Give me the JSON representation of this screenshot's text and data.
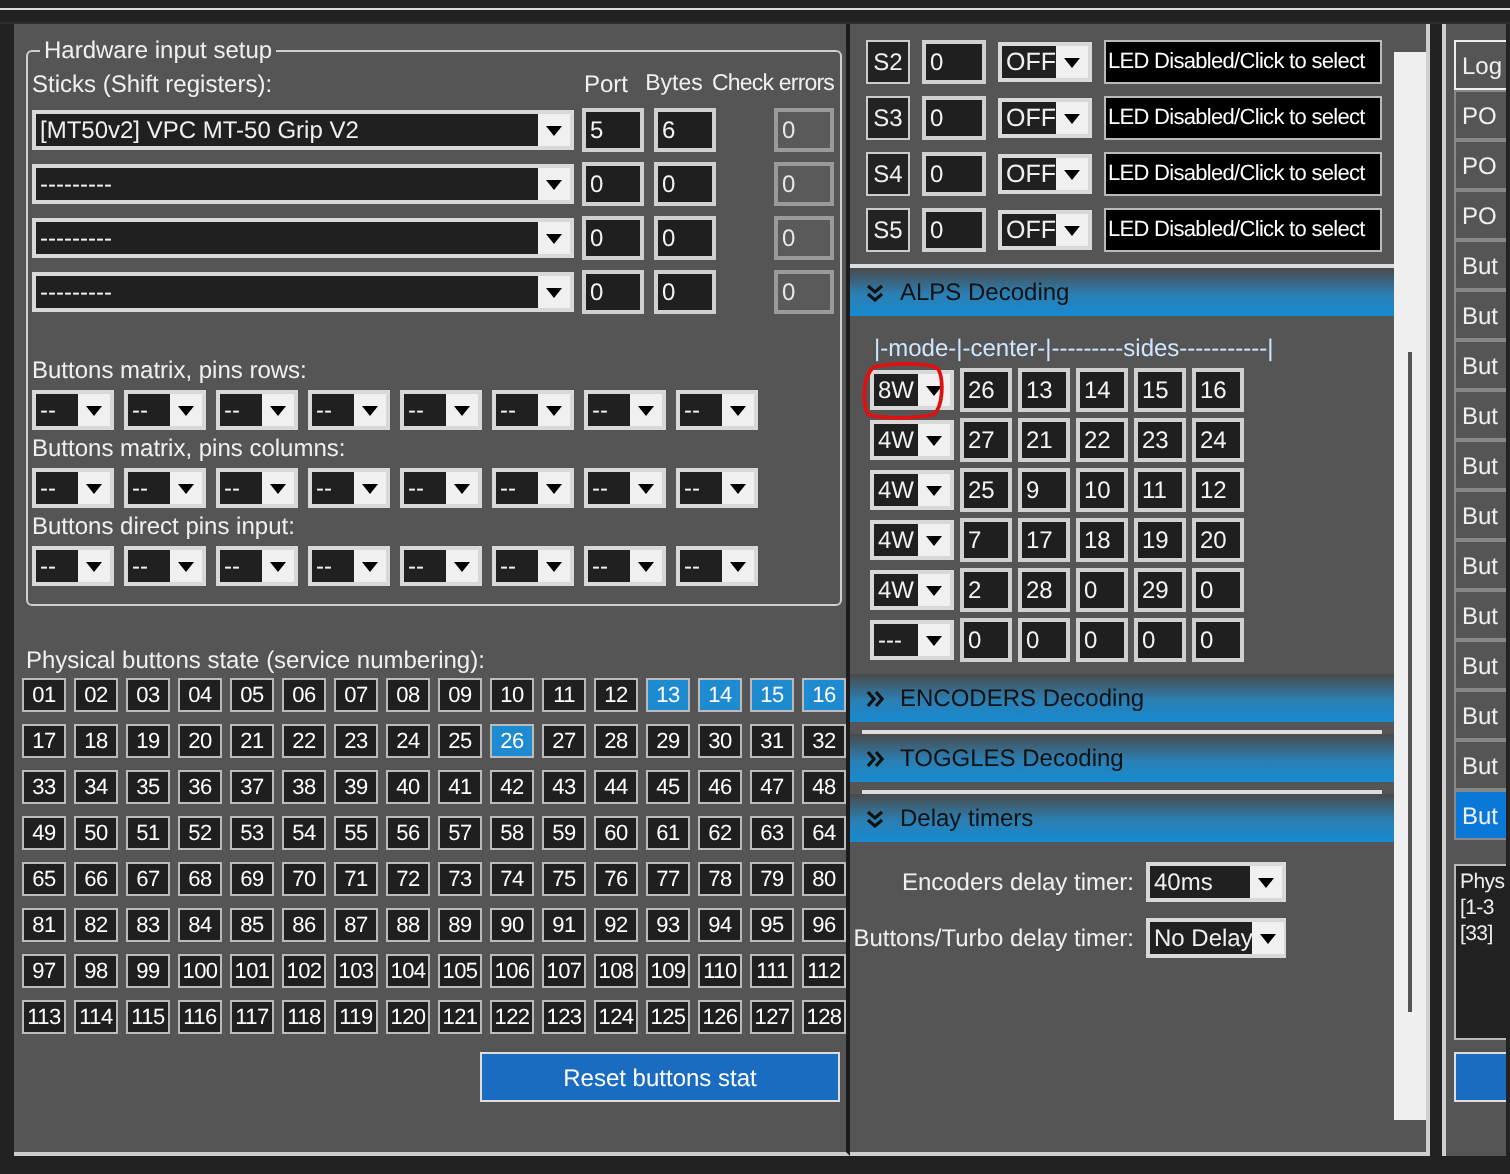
{
  "hardware_input_setup": {
    "title": "Hardware input setup",
    "sticks_label": "Sticks (Shift registers):",
    "column_headers": [
      "Port",
      "Bytes",
      "Check errors"
    ],
    "sticks": [
      {
        "device": "[MT50v2] VPC MT-50 Grip V2",
        "port": "5",
        "bytes": "6",
        "check_errors": "0"
      },
      {
        "device": "---------",
        "port": "0",
        "bytes": "0",
        "check_errors": "0"
      },
      {
        "device": "---------",
        "port": "0",
        "bytes": "0",
        "check_errors": "0"
      },
      {
        "device": "---------",
        "port": "0",
        "bytes": "0",
        "check_errors": "0"
      }
    ],
    "pin_groups": [
      {
        "label": "Buttons matrix, pins rows:",
        "pins": [
          "--",
          "--",
          "--",
          "--",
          "--",
          "--",
          "--",
          "--"
        ]
      },
      {
        "label": "Buttons matrix, pins columns:",
        "pins": [
          "--",
          "--",
          "--",
          "--",
          "--",
          "--",
          "--",
          "--"
        ]
      },
      {
        "label": "Buttons direct pins input:",
        "pins": [
          "--",
          "--",
          "--",
          "--",
          "--",
          "--",
          "--",
          "--"
        ]
      }
    ]
  },
  "physical_buttons": {
    "label": "Physical buttons state (service numbering):",
    "buttons": [
      {
        "number": "01",
        "pressed": false
      },
      {
        "number": "02",
        "pressed": false
      },
      {
        "number": "03",
        "pressed": false
      },
      {
        "number": "04",
        "pressed": false
      },
      {
        "number": "05",
        "pressed": false
      },
      {
        "number": "06",
        "pressed": false
      },
      {
        "number": "07",
        "pressed": false
      },
      {
        "number": "08",
        "pressed": false
      },
      {
        "number": "09",
        "pressed": false
      },
      {
        "number": "10",
        "pressed": false
      },
      {
        "number": "11",
        "pressed": false
      },
      {
        "number": "12",
        "pressed": false
      },
      {
        "number": "13",
        "pressed": true
      },
      {
        "number": "14",
        "pressed": true
      },
      {
        "number": "15",
        "pressed": true
      },
      {
        "number": "16",
        "pressed": true
      },
      {
        "number": "17",
        "pressed": false
      },
      {
        "number": "18",
        "pressed": false
      },
      {
        "number": "19",
        "pressed": false
      },
      {
        "number": "20",
        "pressed": false
      },
      {
        "number": "21",
        "pressed": false
      },
      {
        "number": "22",
        "pressed": false
      },
      {
        "number": "23",
        "pressed": false
      },
      {
        "number": "24",
        "pressed": false
      },
      {
        "number": "25",
        "pressed": false
      },
      {
        "number": "26",
        "pressed": true
      },
      {
        "number": "27",
        "pressed": false
      },
      {
        "number": "28",
        "pressed": false
      },
      {
        "number": "29",
        "pressed": false
      },
      {
        "number": "30",
        "pressed": false
      },
      {
        "number": "31",
        "pressed": false
      },
      {
        "number": "32",
        "pressed": false
      },
      {
        "number": "33",
        "pressed": false
      },
      {
        "number": "34",
        "pressed": false
      },
      {
        "number": "35",
        "pressed": false
      },
      {
        "number": "36",
        "pressed": false
      },
      {
        "number": "37",
        "pressed": false
      },
      {
        "number": "38",
        "pressed": false
      },
      {
        "number": "39",
        "pressed": false
      },
      {
        "number": "40",
        "pressed": false
      },
      {
        "number": "41",
        "pressed": false
      },
      {
        "number": "42",
        "pressed": false
      },
      {
        "number": "43",
        "pressed": false
      },
      {
        "number": "44",
        "pressed": false
      },
      {
        "number": "45",
        "pressed": false
      },
      {
        "number": "46",
        "pressed": false
      },
      {
        "number": "47",
        "pressed": false
      },
      {
        "number": "48",
        "pressed": false
      },
      {
        "number": "49",
        "pressed": false
      },
      {
        "number": "50",
        "pressed": false
      },
      {
        "number": "51",
        "pressed": false
      },
      {
        "number": "52",
        "pressed": false
      },
      {
        "number": "53",
        "pressed": false
      },
      {
        "number": "54",
        "pressed": false
      },
      {
        "number": "55",
        "pressed": false
      },
      {
        "number": "56",
        "pressed": false
      },
      {
        "number": "57",
        "pressed": false
      },
      {
        "number": "58",
        "pressed": false
      },
      {
        "number": "59",
        "pressed": false
      },
      {
        "number": "60",
        "pressed": false
      },
      {
        "number": "61",
        "pressed": false
      },
      {
        "number": "62",
        "pressed": false
      },
      {
        "number": "63",
        "pressed": false
      },
      {
        "number": "64",
        "pressed": false
      },
      {
        "number": "65",
        "pressed": false
      },
      {
        "number": "66",
        "pressed": false
      },
      {
        "number": "67",
        "pressed": false
      },
      {
        "number": "68",
        "pressed": false
      },
      {
        "number": "69",
        "pressed": false
      },
      {
        "number": "70",
        "pressed": false
      },
      {
        "number": "71",
        "pressed": false
      },
      {
        "number": "72",
        "pressed": false
      },
      {
        "number": "73",
        "pressed": false
      },
      {
        "number": "74",
        "pressed": false
      },
      {
        "number": "75",
        "pressed": false
      },
      {
        "number": "76",
        "pressed": false
      },
      {
        "number": "77",
        "pressed": false
      },
      {
        "number": "78",
        "pressed": false
      },
      {
        "number": "79",
        "pressed": false
      },
      {
        "number": "80",
        "pressed": false
      },
      {
        "number": "81",
        "pressed": false
      },
      {
        "number": "82",
        "pressed": false
      },
      {
        "number": "83",
        "pressed": false
      },
      {
        "number": "84",
        "pressed": false
      },
      {
        "number": "85",
        "pressed": false
      },
      {
        "number": "86",
        "pressed": false
      },
      {
        "number": "87",
        "pressed": false
      },
      {
        "number": "88",
        "pressed": false
      },
      {
        "number": "89",
        "pressed": false
      },
      {
        "number": "90",
        "pressed": false
      },
      {
        "number": "91",
        "pressed": false
      },
      {
        "number": "92",
        "pressed": false
      },
      {
        "number": "93",
        "pressed": false
      },
      {
        "number": "94",
        "pressed": false
      },
      {
        "number": "95",
        "pressed": false
      },
      {
        "number": "96",
        "pressed": false
      },
      {
        "number": "97",
        "pressed": false
      },
      {
        "number": "98",
        "pressed": false
      },
      {
        "number": "99",
        "pressed": false
      },
      {
        "number": "100",
        "pressed": false
      },
      {
        "number": "101",
        "pressed": false
      },
      {
        "number": "102",
        "pressed": false
      },
      {
        "number": "103",
        "pressed": false
      },
      {
        "number": "104",
        "pressed": false
      },
      {
        "number": "105",
        "pressed": false
      },
      {
        "number": "106",
        "pressed": false
      },
      {
        "number": "107",
        "pressed": false
      },
      {
        "number": "108",
        "pressed": false
      },
      {
        "number": "109",
        "pressed": false
      },
      {
        "number": "110",
        "pressed": false
      },
      {
        "number": "111",
        "pressed": false
      },
      {
        "number": "112",
        "pressed": false
      },
      {
        "number": "113",
        "pressed": false
      },
      {
        "number": "114",
        "pressed": false
      },
      {
        "number": "115",
        "pressed": false
      },
      {
        "number": "116",
        "pressed": false
      },
      {
        "number": "117",
        "pressed": false
      },
      {
        "number": "118",
        "pressed": false
      },
      {
        "number": "119",
        "pressed": false
      },
      {
        "number": "120",
        "pressed": false
      },
      {
        "number": "121",
        "pressed": false
      },
      {
        "number": "122",
        "pressed": false
      },
      {
        "number": "123",
        "pressed": false
      },
      {
        "number": "124",
        "pressed": false
      },
      {
        "number": "125",
        "pressed": false
      },
      {
        "number": "126",
        "pressed": false
      },
      {
        "number": "127",
        "pressed": false
      },
      {
        "number": "128",
        "pressed": false
      }
    ],
    "reset_button": "Reset buttons stat"
  },
  "shift_registers": [
    {
      "label": "S2",
      "value": "0",
      "mode": "OFF",
      "led": "LED Disabled/Click to select"
    },
    {
      "label": "S3",
      "value": "0",
      "mode": "OFF",
      "led": "LED Disabled/Click to select"
    },
    {
      "label": "S4",
      "value": "0",
      "mode": "OFF",
      "led": "LED Disabled/Click to select"
    },
    {
      "label": "S5",
      "value": "0",
      "mode": "OFF",
      "led": "LED Disabled/Click to select"
    }
  ],
  "sections": [
    {
      "kind": "alps",
      "title": "ALPS Decoding",
      "expanded": true,
      "header": "|-mode-|-center-|---------sides-----------|",
      "rows": [
        {
          "mode": "8W",
          "values": [
            "26",
            "13",
            "14",
            "15",
            "16"
          ]
        },
        {
          "mode": "4W",
          "values": [
            "27",
            "21",
            "22",
            "23",
            "24"
          ]
        },
        {
          "mode": "4W",
          "values": [
            "25",
            "9",
            "10",
            "11",
            "12"
          ]
        },
        {
          "mode": "4W",
          "values": [
            "7",
            "17",
            "18",
            "19",
            "20"
          ]
        },
        {
          "mode": "4W",
          "values": [
            "2",
            "28",
            "0",
            "29",
            "0"
          ]
        },
        {
          "mode": "---",
          "values": [
            "0",
            "0",
            "0",
            "0",
            "0"
          ]
        }
      ]
    },
    {
      "kind": "plain",
      "title": "ENCODERS Decoding",
      "expanded": false
    },
    {
      "kind": "plain",
      "title": "TOGGLES Decoding",
      "expanded": false
    },
    {
      "kind": "timers",
      "title": "Delay timers",
      "expanded": true,
      "timers": [
        {
          "label": "Encoders delay timer:",
          "value": "40ms"
        },
        {
          "label": "Buttons/Turbo delay timer:",
          "value": "No Delay"
        }
      ]
    }
  ],
  "right_panel": {
    "list": [
      {
        "label": "Log",
        "selected": false
      },
      {
        "label": "PO",
        "selected": false
      },
      {
        "label": "PO",
        "selected": false
      },
      {
        "label": "PO",
        "selected": false
      },
      {
        "label": "But",
        "selected": false
      },
      {
        "label": "But",
        "selected": false
      },
      {
        "label": "But",
        "selected": false
      },
      {
        "label": "But",
        "selected": false
      },
      {
        "label": "But",
        "selected": false
      },
      {
        "label": "But",
        "selected": false
      },
      {
        "label": "But",
        "selected": false
      },
      {
        "label": "But",
        "selected": false
      },
      {
        "label": "But",
        "selected": false
      },
      {
        "label": "But",
        "selected": false
      },
      {
        "label": "But",
        "selected": false
      },
      {
        "label": "But",
        "selected": true
      }
    ],
    "log_lines": [
      "Phys",
      "[1-3",
      "[33]"
    ]
  }
}
